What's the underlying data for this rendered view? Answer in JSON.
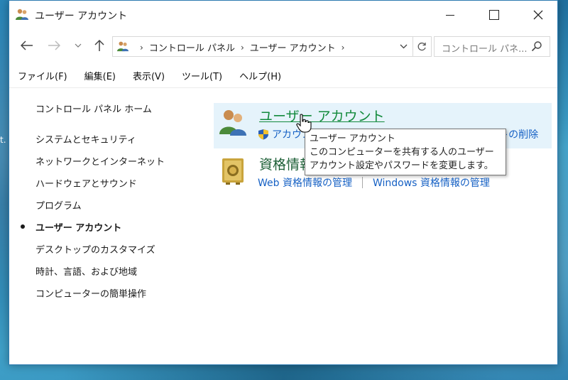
{
  "window": {
    "title": "ユーザー アカウント"
  },
  "address": {
    "crumbs": [
      "コントロール パネル",
      "ユーザー アカウント"
    ],
    "search_placeholder": "コントロール パネ..."
  },
  "menu": [
    "ファイル(F)",
    "編集(E)",
    "表示(V)",
    "ツール(T)",
    "ヘルプ(H)"
  ],
  "left_nav": {
    "home": "コントロール パネル ホーム",
    "items": [
      "システムとセキュリティ",
      "ネットワークとインターネット",
      "ハードウェアとサウンド",
      "プログラム",
      "ユーザー アカウント",
      "デスクトップのカスタマイズ",
      "時計、言語、および地域",
      "コンピューターの簡単操作"
    ],
    "current_index": 4
  },
  "categories": [
    {
      "title": "ユーザー アカウント",
      "links": [
        "アカウントの種類の変更",
        "ユーザー アカウントの削除"
      ]
    },
    {
      "title": "資格情報マネージャー",
      "links": [
        "Web 資格情報の管理",
        "Windows 資格情報の管理"
      ]
    }
  ],
  "tooltip": {
    "title": "ユーザー アカウント",
    "body": "このコンピューターを共有する人のユーザー アカウント設定やパスワードを変更します。"
  },
  "desktop": {
    "edge_text": "t."
  },
  "colors": {
    "link_blue": "#1560c4",
    "category_green": "#128a3c",
    "hover_bg": "#e5f3fb"
  }
}
